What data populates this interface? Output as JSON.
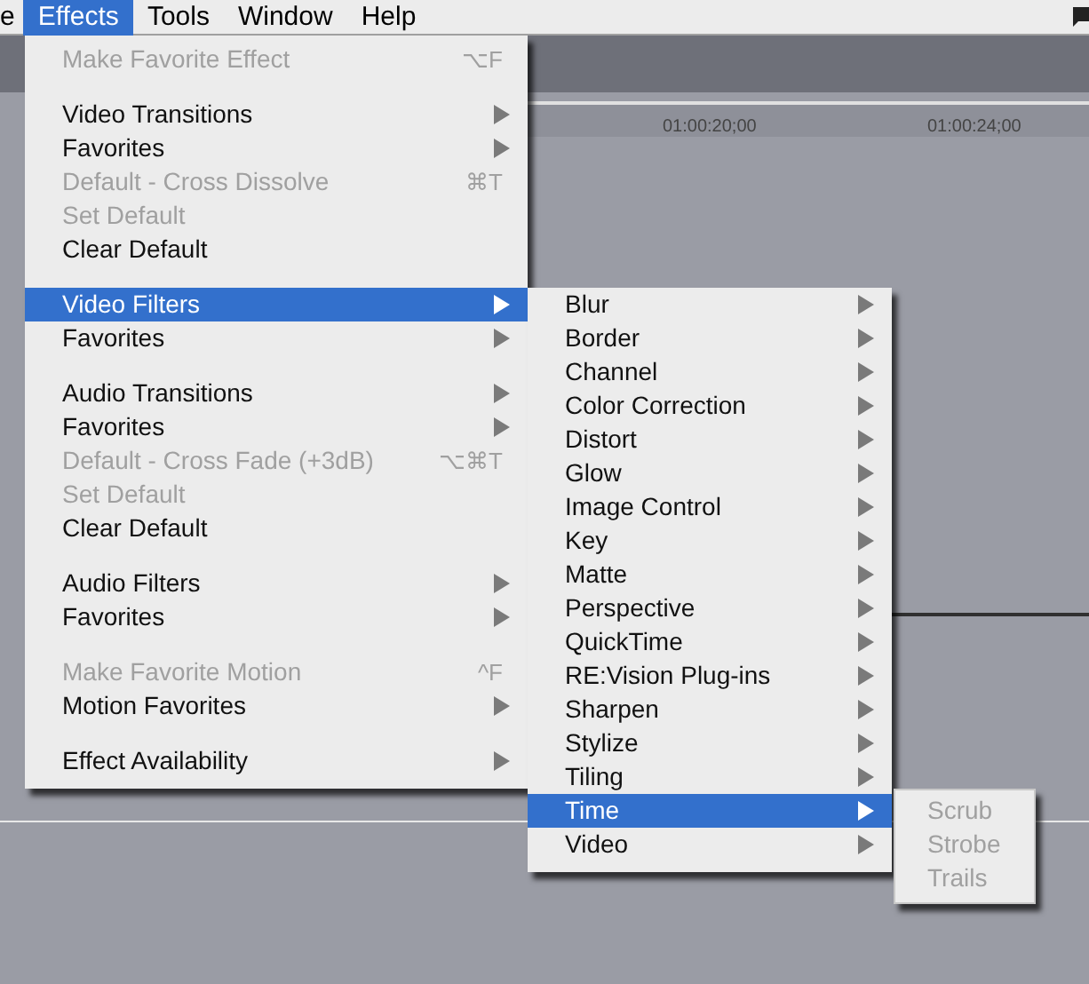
{
  "menu_bar": [
    {
      "label": "e",
      "selected": false
    },
    {
      "label": "Effects",
      "selected": true
    },
    {
      "label": "Tools",
      "selected": false
    },
    {
      "label": "Window",
      "selected": false
    },
    {
      "label": "Help",
      "selected": false
    }
  ],
  "timeline": {
    "timecodes": [
      "01:00:20;00",
      "01:00:24;00"
    ]
  },
  "effects_menu": {
    "sections": [
      [
        {
          "label": "Make Favorite Effect",
          "shortcut": "⌥F",
          "disabled": true,
          "has_submenu": false,
          "selected": false
        }
      ],
      [
        {
          "label": "Video Transitions",
          "disabled": false,
          "has_submenu": true,
          "selected": false
        },
        {
          "label": "Favorites",
          "disabled": false,
          "has_submenu": true,
          "selected": false
        },
        {
          "label": "Default - Cross Dissolve",
          "shortcut": "⌘T",
          "disabled": true,
          "has_submenu": false,
          "selected": false
        },
        {
          "label": "Set Default",
          "disabled": true,
          "has_submenu": false,
          "selected": false
        },
        {
          "label": "Clear Default",
          "disabled": false,
          "has_submenu": false,
          "selected": false
        }
      ],
      [
        {
          "label": "Video Filters",
          "disabled": false,
          "has_submenu": true,
          "selected": true
        },
        {
          "label": "Favorites",
          "disabled": false,
          "has_submenu": true,
          "selected": false
        }
      ],
      [
        {
          "label": "Audio Transitions",
          "disabled": false,
          "has_submenu": true,
          "selected": false
        },
        {
          "label": "Favorites",
          "disabled": false,
          "has_submenu": true,
          "selected": false
        },
        {
          "label": "Default - Cross Fade (+3dB)",
          "shortcut": "⌥⌘T",
          "disabled": true,
          "has_submenu": false,
          "selected": false
        },
        {
          "label": "Set Default",
          "disabled": true,
          "has_submenu": false,
          "selected": false
        },
        {
          "label": "Clear Default",
          "disabled": false,
          "has_submenu": false,
          "selected": false
        }
      ],
      [
        {
          "label": "Audio Filters",
          "disabled": false,
          "has_submenu": true,
          "selected": false
        },
        {
          "label": "Favorites",
          "disabled": false,
          "has_submenu": true,
          "selected": false
        }
      ],
      [
        {
          "label": "Make Favorite Motion",
          "shortcut": "^F",
          "disabled": true,
          "has_submenu": false,
          "selected": false
        },
        {
          "label": "Motion Favorites",
          "disabled": false,
          "has_submenu": true,
          "selected": false
        }
      ],
      [
        {
          "label": "Effect Availability",
          "disabled": false,
          "has_submenu": true,
          "selected": false
        }
      ]
    ]
  },
  "video_filters_menu": {
    "items": [
      {
        "label": "Blur",
        "disabled": false,
        "has_submenu": true,
        "selected": false
      },
      {
        "label": "Border",
        "disabled": false,
        "has_submenu": true,
        "selected": false
      },
      {
        "label": "Channel",
        "disabled": false,
        "has_submenu": true,
        "selected": false
      },
      {
        "label": "Color Correction",
        "disabled": false,
        "has_submenu": true,
        "selected": false
      },
      {
        "label": "Distort",
        "disabled": false,
        "has_submenu": true,
        "selected": false
      },
      {
        "label": "Glow",
        "disabled": false,
        "has_submenu": true,
        "selected": false
      },
      {
        "label": "Image Control",
        "disabled": false,
        "has_submenu": true,
        "selected": false
      },
      {
        "label": "Key",
        "disabled": false,
        "has_submenu": true,
        "selected": false
      },
      {
        "label": "Matte",
        "disabled": false,
        "has_submenu": true,
        "selected": false
      },
      {
        "label": "Perspective",
        "disabled": false,
        "has_submenu": true,
        "selected": false
      },
      {
        "label": "QuickTime",
        "disabled": false,
        "has_submenu": true,
        "selected": false
      },
      {
        "label": "RE:Vision Plug-ins",
        "disabled": false,
        "has_submenu": true,
        "selected": false
      },
      {
        "label": "Sharpen",
        "disabled": false,
        "has_submenu": true,
        "selected": false
      },
      {
        "label": "Stylize",
        "disabled": false,
        "has_submenu": true,
        "selected": false
      },
      {
        "label": "Tiling",
        "disabled": false,
        "has_submenu": true,
        "selected": false
      },
      {
        "label": "Time",
        "disabled": false,
        "has_submenu": true,
        "selected": true
      },
      {
        "label": "Video",
        "disabled": false,
        "has_submenu": true,
        "selected": false
      }
    ]
  },
  "time_menu": {
    "items": [
      {
        "label": "Scrub",
        "disabled": true,
        "has_submenu": false,
        "selected": false
      },
      {
        "label": "Strobe",
        "disabled": true,
        "has_submenu": false,
        "selected": false
      },
      {
        "label": "Trails",
        "disabled": true,
        "has_submenu": false,
        "selected": false
      }
    ]
  }
}
